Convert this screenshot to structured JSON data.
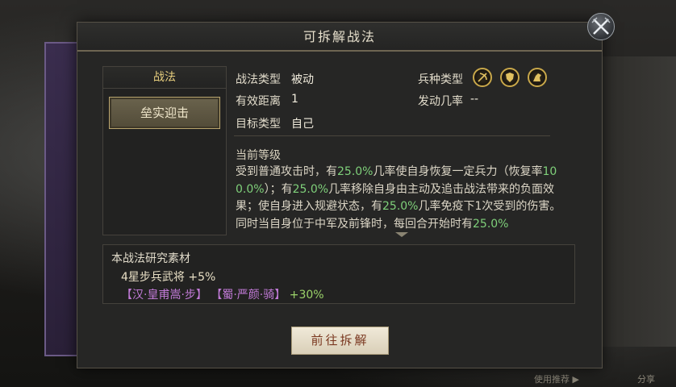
{
  "dialog": {
    "title": "可拆解战法"
  },
  "left": {
    "header": "战法",
    "skill_name": "垒实迎击"
  },
  "info": {
    "type_label": "战法类型",
    "type_value": "被动",
    "range_label": "有效距离",
    "range_value": "1",
    "target_label": "目标类型",
    "target_value": "自己",
    "troop_label": "兵种类型",
    "rate_label": "发动几率",
    "rate_value": "--",
    "troop_icons": [
      "bow-icon",
      "shield-icon",
      "horse-icon"
    ]
  },
  "level": {
    "title": "当前等级",
    "desc": [
      {
        "t": "受到普通攻击时，有"
      },
      {
        "t": "25.0%",
        "hl": true
      },
      {
        "t": "几率使自身恢复一定兵力（恢复率"
      },
      {
        "t": "100.0%",
        "hl": true
      },
      {
        "t": "）；有"
      },
      {
        "t": "25.0%",
        "hl": true
      },
      {
        "t": "几率移除自身由主动及追击战法带来的负面效果；使自身进入规避状态，有"
      },
      {
        "t": "25.0%",
        "hl": true
      },
      {
        "t": "几率免疫下1次受到的伤害。同时当自身位于中军及前锋时，每回合开始时有"
      },
      {
        "t": "25.0%",
        "hl": true
      }
    ]
  },
  "materials": {
    "title": "本战法研究素材",
    "line1": "4星步兵武将 +5%",
    "general_1": "【汉·皇甫嵩·步】",
    "general_2": "【蜀·严颜·骑】",
    "bonus_2": "+30%"
  },
  "go_button": "前往拆解",
  "background": {
    "bottom_right_1": "使用推荐 ▶",
    "bottom_right_2": "分享"
  },
  "colors": {
    "highlight": "#7fd07a",
    "purple": "#c27bd8",
    "gold": "#e8cf7e"
  }
}
